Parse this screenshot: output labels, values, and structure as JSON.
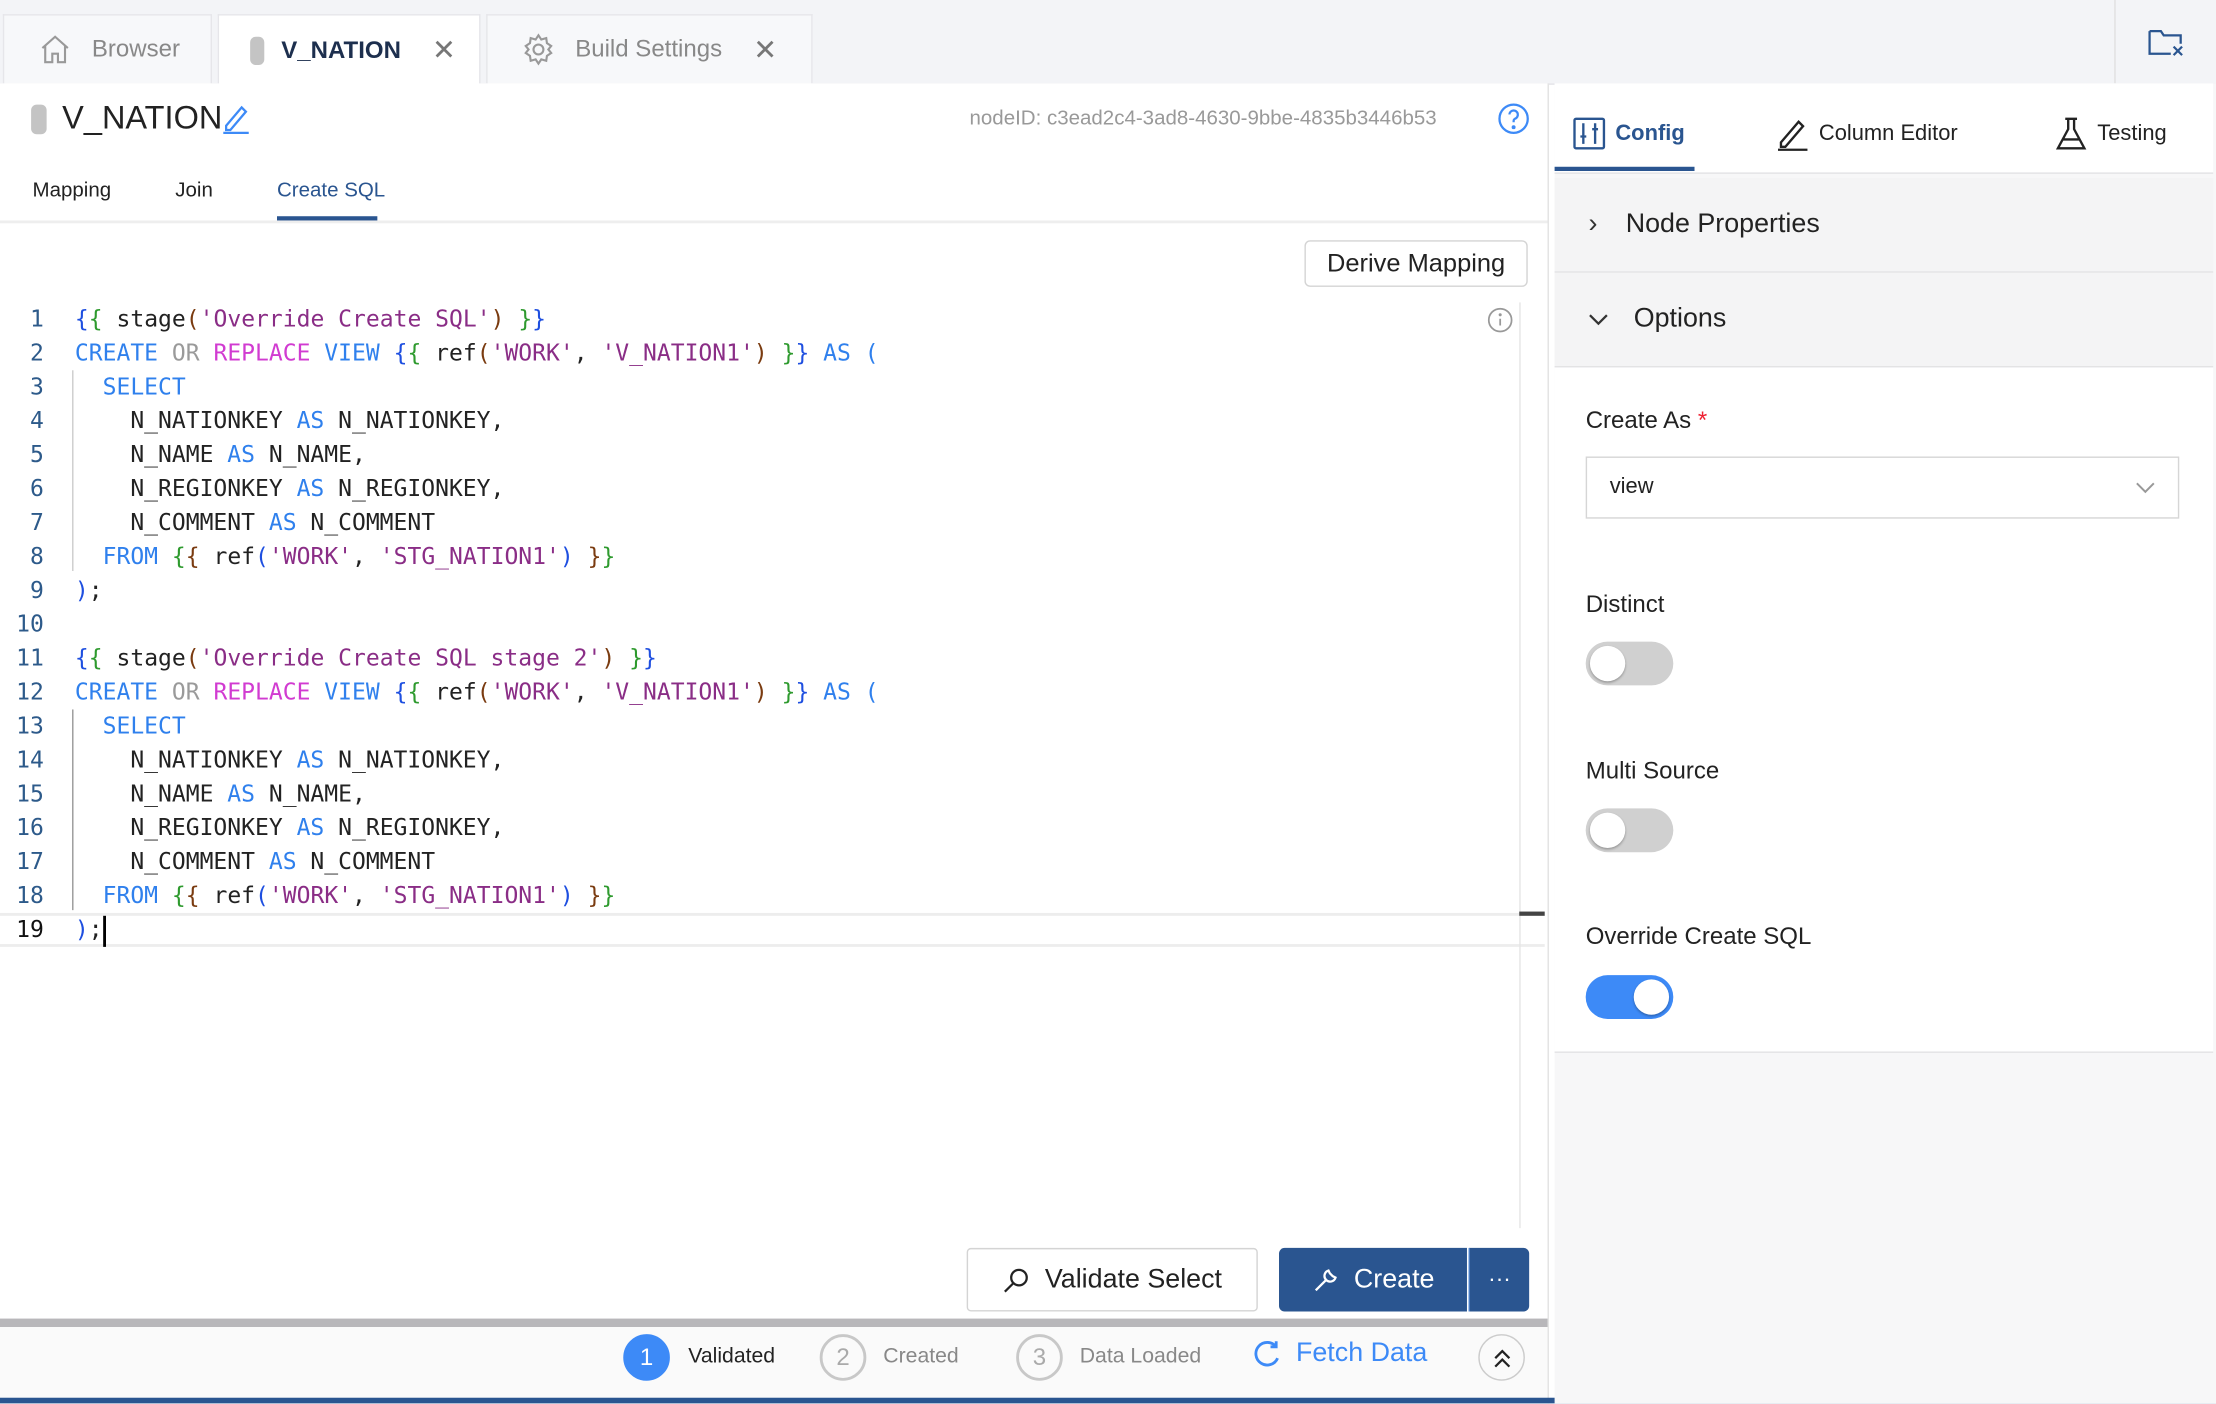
{
  "tabs": [
    {
      "label": "Browser",
      "icon": "home-icon"
    },
    {
      "label": "V_NATION",
      "close": "✕"
    },
    {
      "label": "Build Settings",
      "icon": "gear-icon",
      "close": "✕"
    }
  ],
  "header": {
    "title": "V_NATION",
    "node_id": "nodeID: c3ead2c4-3ad8-4630-9bbe-4835b3446b53"
  },
  "subtabs": [
    "Mapping",
    "Join",
    "Create SQL"
  ],
  "active_subtab": "Create SQL",
  "derive_mapping": "Derive Mapping",
  "code_lines": [
    [
      [
        "b",
        "{"
      ],
      [
        "g",
        "{"
      ],
      [
        "t",
        " stage"
      ],
      [
        "p",
        "("
      ],
      [
        "s",
        "'Override Create SQL'"
      ],
      [
        "p",
        ")"
      ],
      [
        "t",
        " "
      ],
      [
        "g",
        "}"
      ],
      [
        "b",
        "}"
      ]
    ],
    [
      [
        "k",
        "CREATE "
      ],
      [
        "o",
        "OR "
      ],
      [
        "r",
        "REPLACE "
      ],
      [
        "k",
        "VIEW "
      ],
      [
        "b",
        "{"
      ],
      [
        "g",
        "{"
      ],
      [
        "t",
        " ref"
      ],
      [
        "p",
        "("
      ],
      [
        "s",
        "'WORK'"
      ],
      [
        "t",
        ", "
      ],
      [
        "s",
        "'V_NATION1'"
      ],
      [
        "p",
        ")"
      ],
      [
        "t",
        " "
      ],
      [
        "g",
        "}"
      ],
      [
        "b",
        "}"
      ],
      [
        "k",
        " AS ("
      ]
    ],
    [
      [
        "k",
        "  SELECT"
      ]
    ],
    [
      [
        "t",
        "    N_NATIONKEY "
      ],
      [
        "k",
        "AS"
      ],
      [
        "t",
        " N_NATIONKEY,"
      ]
    ],
    [
      [
        "t",
        "    N_NAME "
      ],
      [
        "k",
        "AS"
      ],
      [
        "t",
        " N_NAME,"
      ]
    ],
    [
      [
        "t",
        "    N_REGIONKEY "
      ],
      [
        "k",
        "AS"
      ],
      [
        "t",
        " N_REGIONKEY,"
      ]
    ],
    [
      [
        "t",
        "    N_COMMENT "
      ],
      [
        "k",
        "AS"
      ],
      [
        "t",
        " N_COMMENT"
      ]
    ],
    [
      [
        "k",
        "  FROM "
      ],
      [
        "g",
        "{"
      ],
      [
        "p",
        "{"
      ],
      [
        "t",
        " ref"
      ],
      [
        "b",
        "("
      ],
      [
        "s",
        "'WORK'"
      ],
      [
        "t",
        ", "
      ],
      [
        "s",
        "'STG_NATION1'"
      ],
      [
        "b",
        ")"
      ],
      [
        "t",
        " "
      ],
      [
        "p",
        "}"
      ],
      [
        "g",
        "}"
      ]
    ],
    [
      [
        "b",
        ")"
      ],
      [
        "t",
        ";"
      ]
    ],
    [],
    [
      [
        "b",
        "{"
      ],
      [
        "g",
        "{"
      ],
      [
        "t",
        " stage"
      ],
      [
        "p",
        "("
      ],
      [
        "s",
        "'Override Create SQL stage 2'"
      ],
      [
        "p",
        ")"
      ],
      [
        "t",
        " "
      ],
      [
        "g",
        "}"
      ],
      [
        "b",
        "}"
      ]
    ],
    [
      [
        "k",
        "CREATE "
      ],
      [
        "o",
        "OR "
      ],
      [
        "r",
        "REPLACE "
      ],
      [
        "k",
        "VIEW "
      ],
      [
        "b",
        "{"
      ],
      [
        "g",
        "{"
      ],
      [
        "t",
        " ref"
      ],
      [
        "p",
        "("
      ],
      [
        "s",
        "'WORK'"
      ],
      [
        "t",
        ", "
      ],
      [
        "s",
        "'V_NATION1'"
      ],
      [
        "p",
        ")"
      ],
      [
        "t",
        " "
      ],
      [
        "g",
        "}"
      ],
      [
        "b",
        "}"
      ],
      [
        "k",
        " AS ("
      ]
    ],
    [
      [
        "k",
        "  SELECT"
      ]
    ],
    [
      [
        "t",
        "    N_NATIONKEY "
      ],
      [
        "k",
        "AS"
      ],
      [
        "t",
        " N_NATIONKEY,"
      ]
    ],
    [
      [
        "t",
        "    N_NAME "
      ],
      [
        "k",
        "AS"
      ],
      [
        "t",
        " N_NAME,"
      ]
    ],
    [
      [
        "t",
        "    N_REGIONKEY "
      ],
      [
        "k",
        "AS"
      ],
      [
        "t",
        " N_REGIONKEY,"
      ]
    ],
    [
      [
        "t",
        "    N_COMMENT "
      ],
      [
        "k",
        "AS"
      ],
      [
        "t",
        " N_COMMENT"
      ]
    ],
    [
      [
        "k",
        "  FROM "
      ],
      [
        "g",
        "{"
      ],
      [
        "p",
        "{"
      ],
      [
        "t",
        " ref"
      ],
      [
        "b",
        "("
      ],
      [
        "s",
        "'WORK'"
      ],
      [
        "t",
        ", "
      ],
      [
        "s",
        "'STG_NATION1'"
      ],
      [
        "b",
        ")"
      ],
      [
        "t",
        " "
      ],
      [
        "p",
        "}"
      ],
      [
        "g",
        "}"
      ]
    ],
    [
      [
        "b",
        ")"
      ],
      [
        "t",
        ";"
      ]
    ]
  ],
  "actions": {
    "validate": "Validate Select",
    "create": "Create",
    "more": "···"
  },
  "status": {
    "steps": [
      {
        "num": "1",
        "label": "Validated",
        "done": true
      },
      {
        "num": "2",
        "label": "Created",
        "done": false
      },
      {
        "num": "3",
        "label": "Data Loaded",
        "done": false
      }
    ],
    "fetch": "Fetch Data"
  },
  "right": {
    "tabs": [
      "Config",
      "Column Editor",
      "Testing"
    ],
    "active_tab": "Config",
    "sections": [
      "Node Properties",
      "Options"
    ],
    "create_as_label": "Create As",
    "required": "*",
    "create_as_value": "view",
    "toggles": [
      {
        "label": "Distinct",
        "on": false
      },
      {
        "label": "Multi Source",
        "on": false
      },
      {
        "label": "Override Create SQL",
        "on": true
      }
    ]
  },
  "colors": {
    "accent": "#2a5590",
    "toggle_on": "#3d8af7",
    "link": "#3d8af7"
  }
}
